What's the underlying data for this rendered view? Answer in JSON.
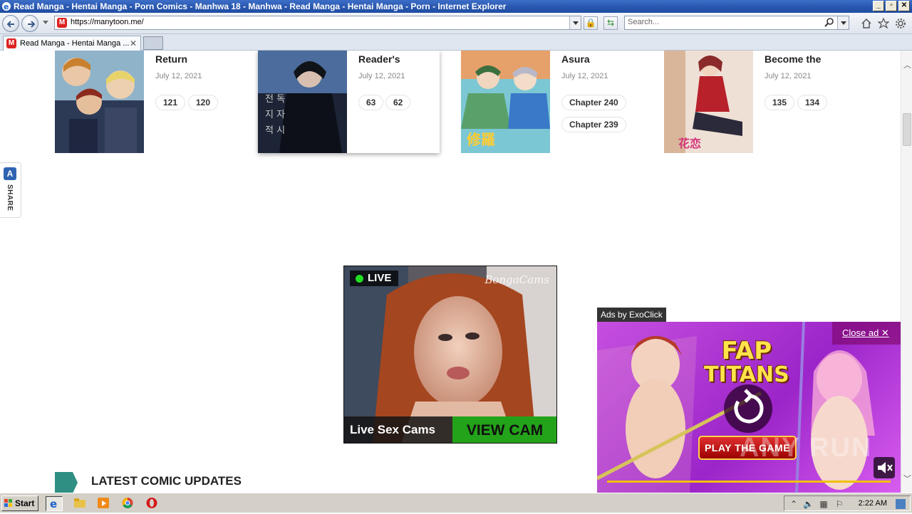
{
  "window": {
    "title": "Read Manga - Hentai Manga - Porn Comics - Manhwa 18 - Manhwa - Read Manga - Hentai Manga - Porn - Internet Explorer"
  },
  "address_bar": {
    "url": "https://manytoon.me/"
  },
  "search_box": {
    "placeholder": "Search..."
  },
  "tab": {
    "title": "Read Manga - Hentai Manga ..."
  },
  "cards": [
    {
      "title": "Return",
      "date": "July 12, 2021",
      "chapters": [
        "121",
        "120"
      ]
    },
    {
      "title": "Reader's",
      "date": "July 12, 2021",
      "chapters": [
        "63",
        "62"
      ]
    },
    {
      "title": "Asura",
      "date": "July 12, 2021",
      "chapters": [
        "Chapter 240",
        "Chapter 239"
      ]
    },
    {
      "title": "Become the",
      "date": "July 12, 2021",
      "chapters": [
        "135",
        "134"
      ]
    }
  ],
  "share_widget": {
    "label": "SHARE"
  },
  "ad_live": {
    "badge": "LIVE",
    "brand": "BongaCams",
    "caption": "Live Sex Cams",
    "cta": "VIEW CAM"
  },
  "ad_exo": {
    "label": "Ads by ExoClick",
    "close": "Close ad ✕",
    "logo_line1": "FAP",
    "logo_line2": "TITANS",
    "cta": "PLAY THE GAME",
    "watermark": "ANY RUN"
  },
  "section": {
    "heading": "LATEST COMIC UPDATES"
  },
  "taskbar": {
    "start": "Start",
    "clock": "2:22 AM"
  },
  "colors": {
    "accent_teal": "#2f8f83",
    "view_cam_green": "#23a319",
    "exo_purple": "#b03fd8"
  }
}
